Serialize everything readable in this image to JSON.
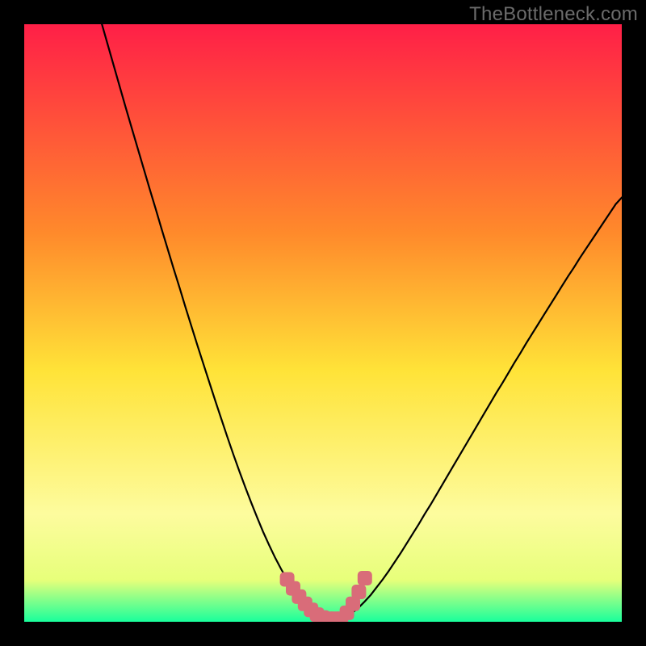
{
  "watermark": "TheBottleneck.com",
  "colors": {
    "frame": "#000000",
    "curve": "#000000",
    "marker": "#d96c79",
    "grad_top": "#ff1f47",
    "grad_mid_upper": "#ff8a2b",
    "grad_mid": "#ffe338",
    "grad_mid_lower": "#fdfc9e",
    "grad_near_bottom": "#e7ff7a",
    "grad_bottom": "#19ff9c"
  },
  "chart_data": {
    "type": "line",
    "title": "",
    "xlabel": "",
    "ylabel": "",
    "xlim": [
      0,
      100
    ],
    "ylim": [
      0,
      100
    ],
    "x": [
      13,
      14,
      15,
      16,
      17,
      18,
      19,
      20,
      21,
      22,
      23,
      24,
      25,
      26,
      27,
      28,
      29,
      30,
      31,
      32,
      33,
      34,
      35,
      36,
      37,
      38,
      39,
      40,
      41,
      42,
      43,
      44,
      45,
      46,
      47,
      48,
      49,
      50,
      51,
      52,
      53,
      54,
      55,
      56,
      57,
      58,
      59,
      60,
      61,
      62,
      63,
      64,
      65,
      66,
      67,
      68,
      69,
      70,
      71,
      72,
      73,
      74,
      75,
      76,
      77,
      78,
      79,
      80,
      81,
      82,
      83,
      84,
      85,
      86,
      87,
      88,
      89,
      90,
      91,
      92,
      93,
      94,
      95,
      96,
      97,
      98,
      99,
      100
    ],
    "values": [
      100.0,
      96.5,
      93.0,
      89.5,
      86.0,
      82.6,
      79.2,
      75.8,
      72.4,
      69.1,
      65.7,
      62.4,
      59.1,
      55.9,
      52.6,
      49.4,
      46.2,
      43.1,
      40.0,
      36.9,
      33.9,
      30.9,
      28.0,
      25.2,
      22.5,
      19.9,
      17.4,
      15.0,
      12.8,
      10.7,
      8.8,
      7.1,
      5.6,
      4.2,
      3.0,
      2.0,
      1.2,
      0.7,
      0.4,
      0.4,
      0.6,
      1.0,
      1.6,
      2.4,
      3.4,
      4.5,
      5.8,
      7.1,
      8.5,
      10.0,
      11.5,
      13.1,
      14.7,
      16.3,
      18.0,
      19.6,
      21.3,
      23.0,
      24.7,
      26.4,
      28.1,
      29.8,
      31.5,
      33.2,
      34.9,
      36.6,
      38.3,
      39.9,
      41.6,
      43.3,
      44.9,
      46.6,
      48.2,
      49.8,
      51.4,
      53.0,
      54.6,
      56.2,
      57.8,
      59.3,
      60.9,
      62.4,
      63.9,
      65.4,
      66.9,
      68.4,
      69.9,
      71.0
    ],
    "markers": {
      "x": [
        44,
        45,
        46,
        47,
        48,
        49,
        50,
        51,
        52,
        53,
        54,
        55,
        56,
        57
      ],
      "y": [
        7.1,
        5.6,
        4.2,
        3.0,
        2.0,
        1.2,
        0.7,
        0.5,
        0.5,
        0.5,
        1.5,
        3.0,
        5.0,
        7.3
      ]
    }
  }
}
